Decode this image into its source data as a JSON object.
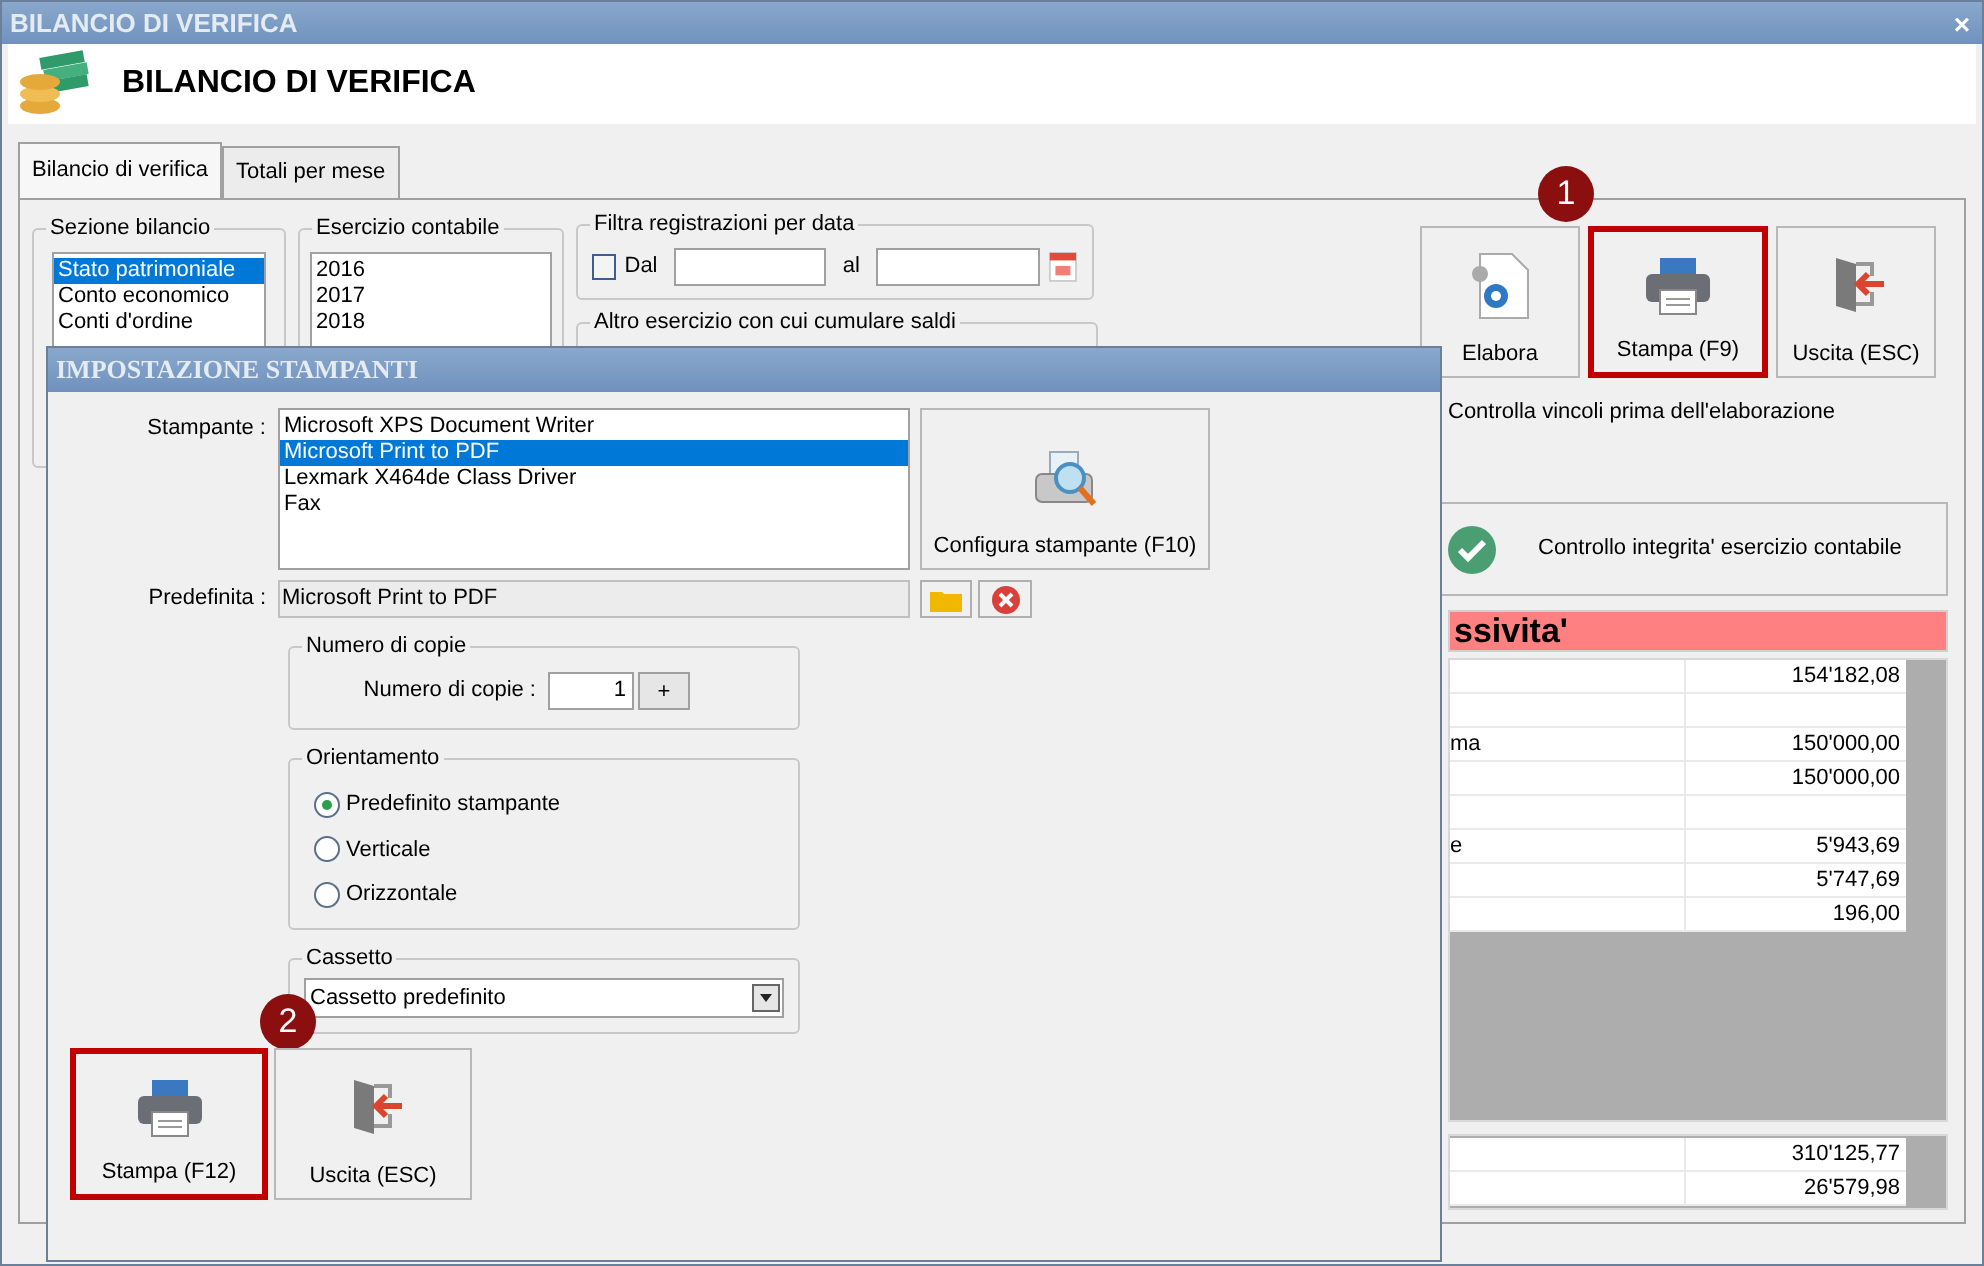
{
  "window": {
    "title": "BILANCIO DI VERIFICA",
    "close": "×"
  },
  "header": {
    "title": "BILANCIO DI VERIFICA"
  },
  "tabs": [
    {
      "label": "Bilancio di verifica",
      "selected": true
    },
    {
      "label": "Totali per mese",
      "selected": false
    }
  ],
  "sezione_bilancio": {
    "title": "Sezione bilancio",
    "items": [
      {
        "label": "Stato patrimoniale",
        "selected": true
      },
      {
        "label": "Conto economico",
        "selected": false
      },
      {
        "label": "Conti d'ordine",
        "selected": false
      }
    ]
  },
  "esercizio_contabile": {
    "title": "Esercizio contabile",
    "items": [
      {
        "label": "2016",
        "selected": false
      },
      {
        "label": "2017",
        "selected": false
      },
      {
        "label": "2018",
        "selected": false
      }
    ]
  },
  "filtra": {
    "title": "Filtra registrazioni per data",
    "dal_label": "Dal",
    "dal_checked": false,
    "al_label": "al"
  },
  "altro_esercizio": {
    "title": "Altro esercizio con cui cumulare saldi"
  },
  "toolbar": [
    {
      "kind": "process",
      "label": "Elabora",
      "highlighted": false
    },
    {
      "kind": "print",
      "label": "Stampa (F9)",
      "highlighted": true,
      "callout": "1"
    },
    {
      "kind": "exit",
      "label": "Uscita (ESC)",
      "highlighted": false
    }
  ],
  "controlla_vincoli": "Controlla vincoli prima dell'elaborazione",
  "integrity_button": "Controllo integrita' esercizio contabile",
  "passivita": {
    "title": "ssivita'",
    "rows": [
      {
        "value": "154'182,08"
      },
      {},
      {
        "label": "ma",
        "value": "150'000,00"
      },
      {
        "value": "150'000,00"
      },
      {},
      {
        "label": "e",
        "value": "5'943,69"
      },
      {
        "value": "5'747,69"
      },
      {
        "value": "196,00"
      }
    ],
    "totals": [
      {
        "value": "310'125,77"
      },
      {
        "value": "26'579,98"
      }
    ]
  },
  "dialog": {
    "title": "IMPOSTAZIONE STAMPANTI",
    "printer_label": "Stampante :",
    "printers": [
      {
        "label": "Microsoft XPS Document Writer",
        "selected": false
      },
      {
        "label": "Microsoft Print to PDF",
        "selected": true
      },
      {
        "label": "Lexmark X464de Class Driver",
        "selected": false
      },
      {
        "label": "Fax",
        "selected": false
      }
    ],
    "configure_button": "Configura stampante (F10)",
    "default_label": "Predefinita :",
    "default_value": "Microsoft Print to PDF",
    "copies": {
      "title": "Numero di copie",
      "label": "Numero di copie :",
      "value": "1",
      "increment": "+"
    },
    "orientation": {
      "title": "Orientamento",
      "options": [
        {
          "label": "Predefinito stampante",
          "selected": true
        },
        {
          "label": "Verticale",
          "selected": false
        },
        {
          "label": "Orizzontale",
          "selected": false
        }
      ]
    },
    "tray": {
      "title": "Cassetto",
      "value": "Cassetto predefinito"
    },
    "buttons": [
      {
        "kind": "print",
        "label": "Stampa (F12)",
        "highlighted": true,
        "callout": "2"
      },
      {
        "kind": "exit",
        "label": "Uscita (ESC)",
        "highlighted": false
      }
    ]
  }
}
